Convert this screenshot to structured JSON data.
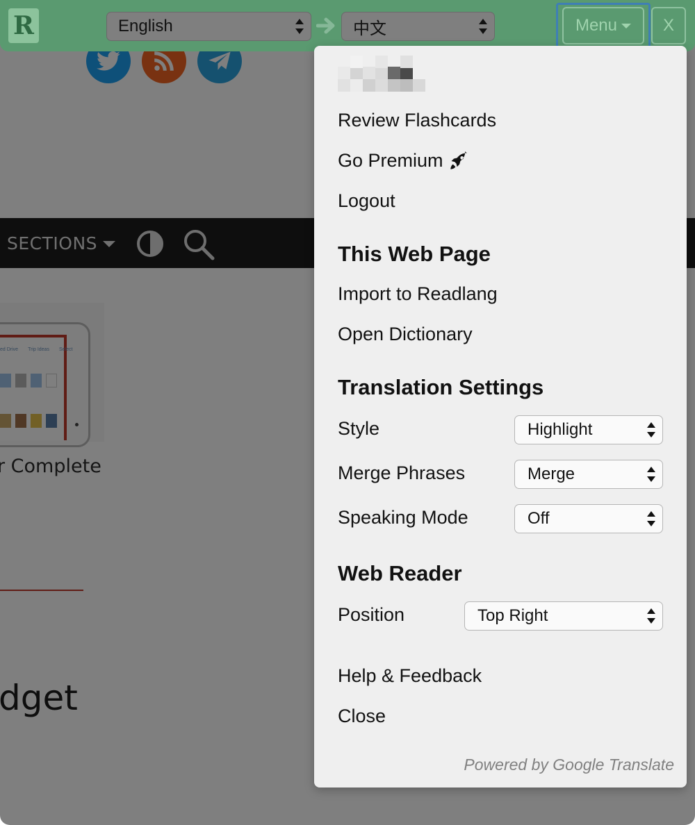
{
  "toolbar": {
    "logo_letter": "R",
    "from_language": "English",
    "to_language": "中文",
    "menu_label": "Menu",
    "close_label": "X"
  },
  "background": {
    "nav_sections_label": "SECTIONS",
    "headline_fragment": "r Complete",
    "title_fragment": "dget",
    "tablet_tabs": [
      "ed Drive",
      "Trip Ideas",
      "Select"
    ]
  },
  "menu": {
    "account_items": [
      {
        "label": "Review Flashcards"
      },
      {
        "label": "Go Premium",
        "icon": "rocket-icon"
      },
      {
        "label": "Logout"
      }
    ],
    "web_page": {
      "heading": "This Web Page",
      "items": [
        "Import to Readlang",
        "Open Dictionary"
      ]
    },
    "translation_settings": {
      "heading": "Translation Settings",
      "style": {
        "label": "Style",
        "value": "Highlight"
      },
      "merge_phrases": {
        "label": "Merge Phrases",
        "value": "Merge"
      },
      "speaking_mode": {
        "label": "Speaking Mode",
        "value": "Off"
      }
    },
    "web_reader": {
      "heading": "Web Reader",
      "position": {
        "label": "Position",
        "value": "Top Right"
      }
    },
    "footer_items": [
      "Help & Feedback",
      "Close"
    ],
    "powered_by": "Powered by Google Translate"
  },
  "colors": {
    "toolbar_green": "#5a9a70",
    "panel_bg": "#efefef",
    "twitter": "#1da1f2",
    "rss": "#f26522",
    "telegram": "#2aa3de"
  }
}
